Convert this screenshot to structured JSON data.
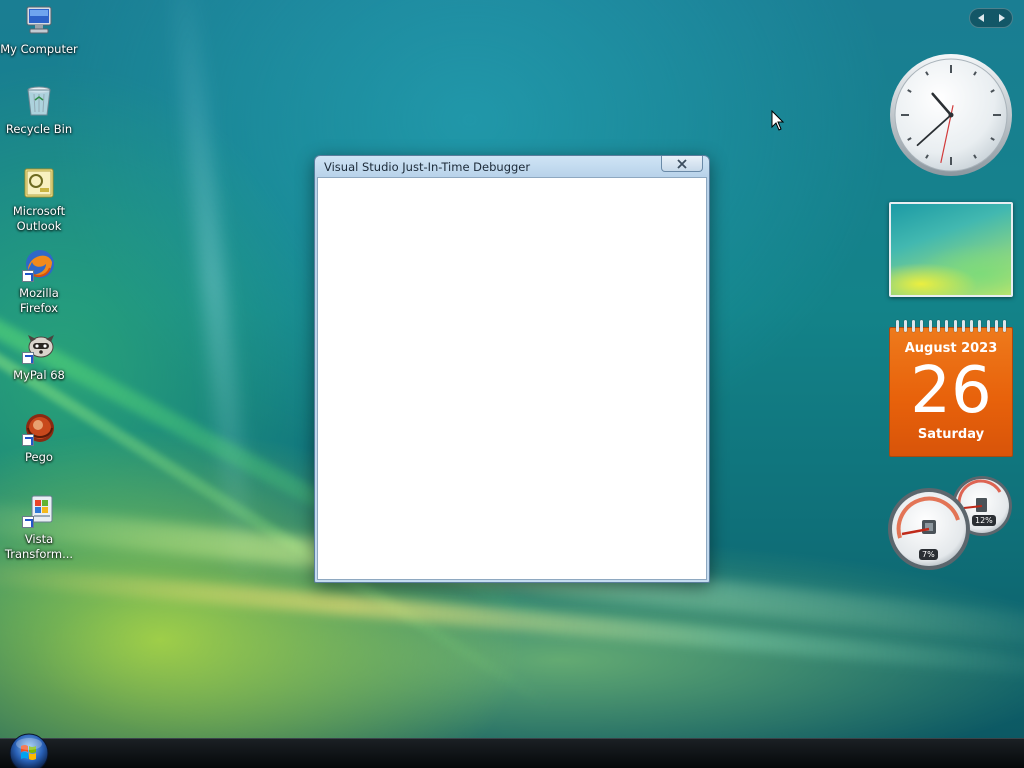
{
  "desktop": {
    "icons": [
      {
        "label": "My Computer",
        "icon": "computer-icon"
      },
      {
        "label": "Recycle Bin",
        "icon": "recycle-bin-icon"
      },
      {
        "label": "Microsoft\nOutlook",
        "icon": "outlook-icon"
      },
      {
        "label": "Mozilla\nFirefox",
        "icon": "firefox-icon"
      },
      {
        "label": "MyPal 68",
        "icon": "mypal-icon"
      },
      {
        "label": "Pego",
        "icon": "pego-icon"
      },
      {
        "label": "Vista\nTransform...",
        "icon": "vista-transformation-icon"
      }
    ]
  },
  "window": {
    "title": "Visual Studio Just-In-Time Debugger",
    "close_icon": "close-icon"
  },
  "sidebar": {
    "nav_icons": [
      "chevron-left-icon",
      "chevron-right-icon"
    ],
    "clock": {
      "hour": 10,
      "minute": 38,
      "second": 32
    },
    "calendar": {
      "month": "August 2023",
      "day": "26",
      "weekday": "Saturday"
    },
    "cpu_meter": {
      "cpu": "7%",
      "memory": "12%"
    }
  },
  "taskbar": {
    "start_icon": "windows-orb-icon"
  },
  "colors": {
    "calendar_orange": "#e8620b",
    "window_frame": "#b9d3ea",
    "taskbar": "#05080a"
  }
}
